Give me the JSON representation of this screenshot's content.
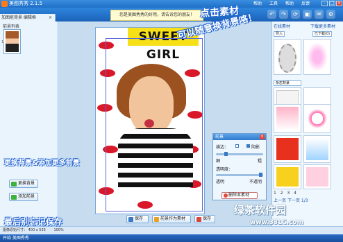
{
  "window": {
    "title": "美图秀秀 2.1.5",
    "menu": [
      "帮助",
      "工具",
      "帮助",
      "反馈"
    ]
  },
  "subtab": {
    "label": "加图抠背景 编辑框"
  },
  "notice": "您是美图秀秀的好用，请告诉您的朋友！",
  "left": {
    "section_title": "前景列表",
    "thumb_index": "1",
    "btn_replace_bg": "更换背景",
    "btn_add_fg": "添加前景"
  },
  "canvas": {
    "poster_text": "SWEET GIRL",
    "btn_save": "保存",
    "btn_save_as_material": "前景作为素材",
    "btn_compose": "保存"
  },
  "dialog": {
    "title": "前景",
    "edge_label": "描边：",
    "shadow_label": "阴影",
    "thin": "细",
    "thick": "粗",
    "opacity_label": "透明度：",
    "transparent": "透明",
    "opaque": "不透明",
    "delete_btn": "删除本素材"
  },
  "right": {
    "tab_online": "在线素材",
    "tab_download": "下载更多素材",
    "btn_import": "导入",
    "btn_history": "已下载(0)",
    "category": "杂志背景",
    "pages": "1 2 3 4",
    "prev": "上一页",
    "next": "下一页",
    "page_info": "1/3"
  },
  "status": {
    "left": "图像原始尺寸：",
    "size": "400 x 533",
    "zoom": "100%"
  },
  "taskbar": {
    "text": "开始 美图秀秀"
  },
  "annotations": {
    "click_material": "点击素材",
    "free_change": "可以随意换背景咯！",
    "change_bg_add_fg": "更换背景&添加更多前景",
    "remember_save": "最后别忘记保存"
  },
  "watermark": {
    "brand": "绿茶软件园",
    "url": "www.33LC.com"
  },
  "colors": {
    "accent": "#1f6fc6",
    "annotation": "#1b5fd0",
    "poster_red": "#d9182a",
    "poster_yellow": "#f7e018"
  }
}
